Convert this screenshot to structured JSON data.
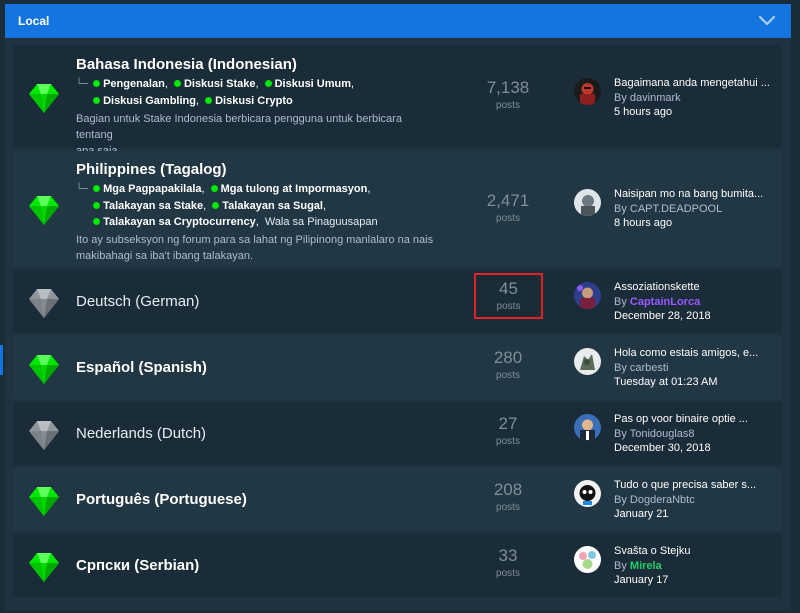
{
  "category": {
    "title": "Local"
  },
  "forums": [
    {
      "title": "Bahasa Indonesia (Indonesian)",
      "unread": true,
      "subforum_lines": [
        [
          {
            "name": "Pengenalan",
            "comma": ","
          },
          {
            "name": "Diskusi Stake",
            "comma": ","
          },
          {
            "name": "Diskusi Umum",
            "comma": ","
          }
        ],
        [
          {
            "name": "Diskusi Gambling",
            "comma": ","
          },
          {
            "name": "Diskusi Crypto",
            "comma": ""
          }
        ]
      ],
      "description_lines": [
        "Bagian untuk Stake Indonesia berbicara pengguna untuk berbicara tentang",
        "apa saja."
      ],
      "posts": "7,138",
      "posts_label": "posts",
      "last_post": {
        "title": "Bagaimana anda mengetahui ...",
        "by": "By",
        "user": "davinmark",
        "time": "5 hours ago"
      }
    },
    {
      "title": "Philippines (Tagalog)",
      "unread": true,
      "subforum_lines": [
        [
          {
            "name": "Mga Pagpapakilala",
            "comma": ","
          },
          {
            "name": "Mga tulong at Impormasyon",
            "comma": ","
          }
        ],
        [
          {
            "name": "Talakayan sa Stake",
            "comma": ","
          },
          {
            "name": "Talakayan sa Sugal",
            "comma": ","
          }
        ],
        [
          {
            "name": "Talakayan sa Cryptocurrency",
            "comma": ","
          },
          {
            "name": "Wala sa Pinaguusapan",
            "comma": ""
          }
        ]
      ],
      "description_lines": [
        "Ito ay subseksyon ng forum para sa lahat ng Pilipinong manlalaro na nais",
        "makibahagi sa iba't ibang talakayan."
      ],
      "posts": "2,471",
      "posts_label": "posts",
      "last_post": {
        "title": "Naisipan mo na bang bumita...",
        "by": "By",
        "user": "CAPT.DEADPOOL",
        "time": "8 hours ago"
      }
    },
    {
      "title": "Deutsch (German)",
      "unread": false,
      "posts": "45",
      "posts_label": "posts",
      "last_post": {
        "title": "Assoziationskette",
        "by": "By",
        "user": "CaptainLorca",
        "time": "December 28, 2018"
      }
    },
    {
      "title": "Español (Spanish)",
      "unread": true,
      "posts": "280",
      "posts_label": "posts",
      "last_post": {
        "title": "Hola como estais amigos, e...",
        "by": "By",
        "user": "carbesti",
        "time": "Tuesday at 01:23 AM"
      }
    },
    {
      "title": "Nederlands (Dutch)",
      "unread": false,
      "posts": "27",
      "posts_label": "posts",
      "last_post": {
        "title": "Pas op voor binaire optie ...",
        "by": "By",
        "user": "Tonidouglas8",
        "time": "December 30, 2018"
      }
    },
    {
      "title": "Português (Portuguese)",
      "unread": true,
      "posts": "208",
      "posts_label": "posts",
      "last_post": {
        "title": "Tudo o que precisa saber s...",
        "by": "By",
        "user": "DogderaNbtc",
        "time": "January 21"
      }
    },
    {
      "title": "Српски (Serbian)",
      "unread": true,
      "posts": "33",
      "posts_label": "posts",
      "last_post": {
        "title": "Svašta o Stejku",
        "by": "By",
        "user": "Mirela",
        "time": "January 17"
      }
    }
  ],
  "colors": {
    "accent": "#1475e1",
    "unread_gem": "#00e701",
    "read_gem": "#9aa0a6",
    "highlight_box": "#e02424",
    "username_purple": "#9b59ff",
    "username_green": "#1fcf6a"
  }
}
